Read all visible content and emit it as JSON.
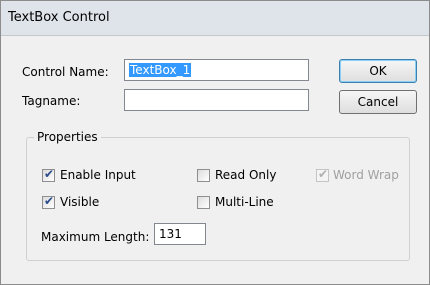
{
  "window": {
    "title": "TextBox Control"
  },
  "fields": {
    "control_name": {
      "label": "Control Name:",
      "value": "TextBox_1"
    },
    "tagname": {
      "label": "Tagname:",
      "value": ""
    }
  },
  "buttons": {
    "ok": "OK",
    "cancel": "Cancel"
  },
  "properties": {
    "legend": "Properties",
    "enable_input": {
      "label": "Enable Input",
      "checked": true
    },
    "read_only": {
      "label": "Read Only",
      "checked": false
    },
    "word_wrap": {
      "label": "Word Wrap",
      "checked": true,
      "disabled": true
    },
    "visible": {
      "label": "Visible",
      "checked": true
    },
    "multi_line": {
      "label": "Multi-Line",
      "checked": false
    },
    "max_length": {
      "label": "Maximum Length:",
      "value": "131"
    }
  }
}
